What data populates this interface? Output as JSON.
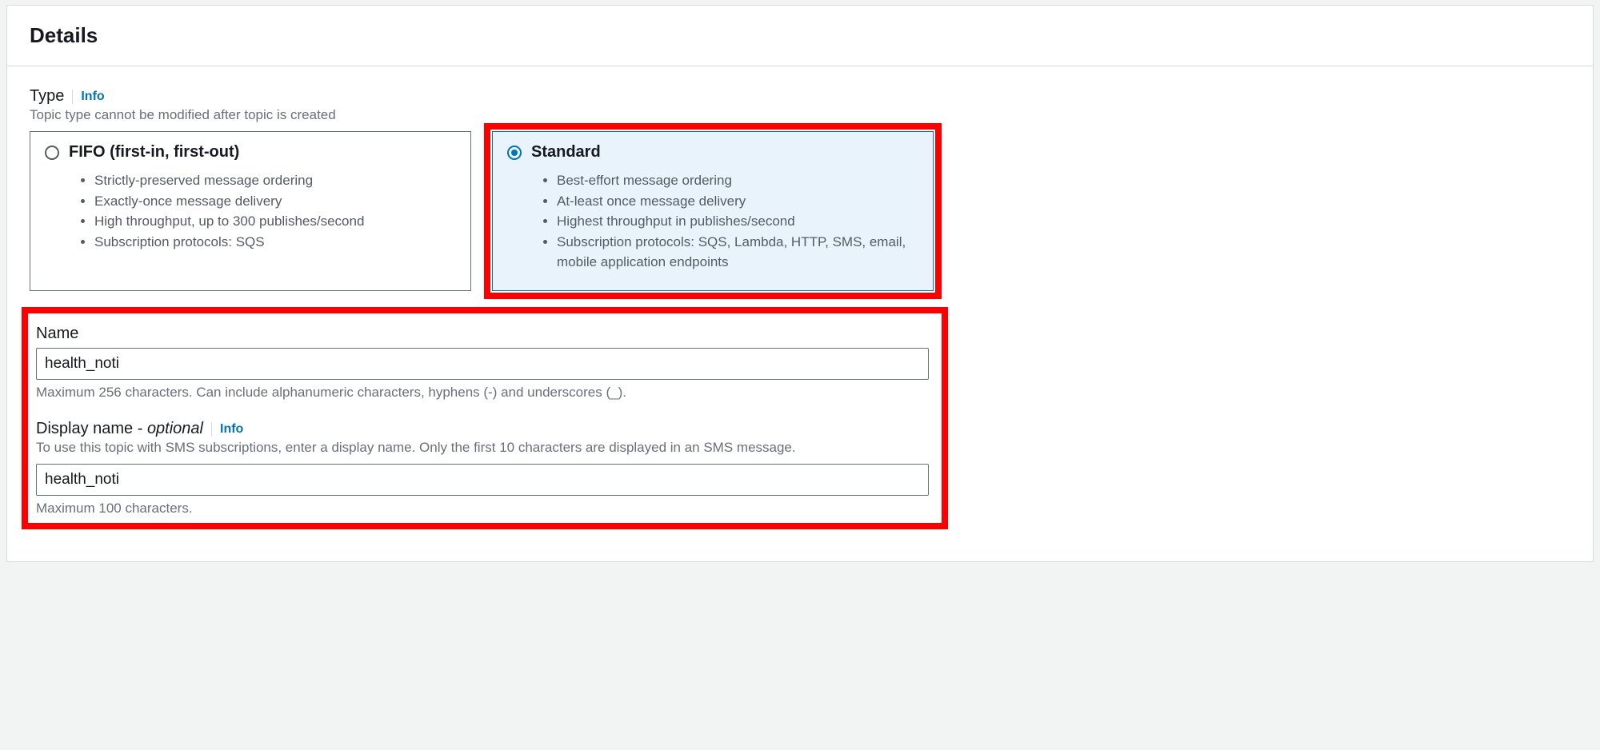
{
  "panel": {
    "title": "Details"
  },
  "type": {
    "label": "Type",
    "info": "Info",
    "helper": "Topic type cannot be modified after topic is created",
    "fifo": {
      "title": "FIFO (first-in, first-out)",
      "selected": false,
      "bullets": [
        "Strictly-preserved message ordering",
        "Exactly-once message delivery",
        "High throughput, up to 300 publishes/second",
        "Subscription protocols: SQS"
      ]
    },
    "standard": {
      "title": "Standard",
      "selected": true,
      "bullets": [
        "Best-effort message ordering",
        "At-least once message delivery",
        "Highest throughput in publishes/second",
        "Subscription protocols: SQS, Lambda, HTTP, SMS, email, mobile application endpoints"
      ]
    }
  },
  "name": {
    "label": "Name",
    "value": "health_noti",
    "helper": "Maximum 256 characters. Can include alphanumeric characters, hyphens (-) and underscores (_)."
  },
  "displayName": {
    "label_prefix": "Display name - ",
    "label_optional": "optional",
    "info": "Info",
    "helper": "To use this topic with SMS subscriptions, enter a display name. Only the first 10 characters are displayed in an SMS message.",
    "value": "health_noti",
    "below": "Maximum 100 characters."
  }
}
